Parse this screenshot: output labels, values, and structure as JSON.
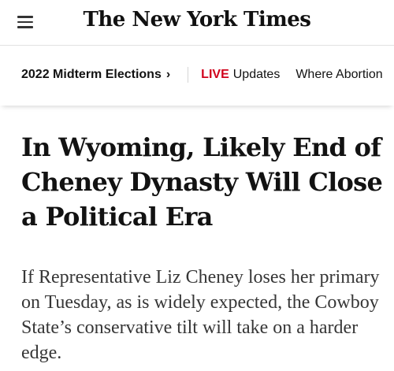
{
  "header": {
    "logo_text": "The New York Times",
    "menu_icon": "hamburger-menu-icon"
  },
  "subnav": {
    "section_label": "2022 Midterm Elections",
    "chevron": "›",
    "live_label": "LIVE",
    "live_text": "Updates",
    "next_item": "Where Abortion"
  },
  "article": {
    "headline": "In Wyoming, Likely End of Cheney Dynasty Will Close a Political Era",
    "summary": "If Representative Liz Cheney loses her primary on Tuesday, as is widely expected, the Cowboy State’s conservative tilt will take on a harder edge."
  },
  "colors": {
    "live_red": "#d0021b",
    "text": "#121212",
    "summary_text": "#363636"
  }
}
